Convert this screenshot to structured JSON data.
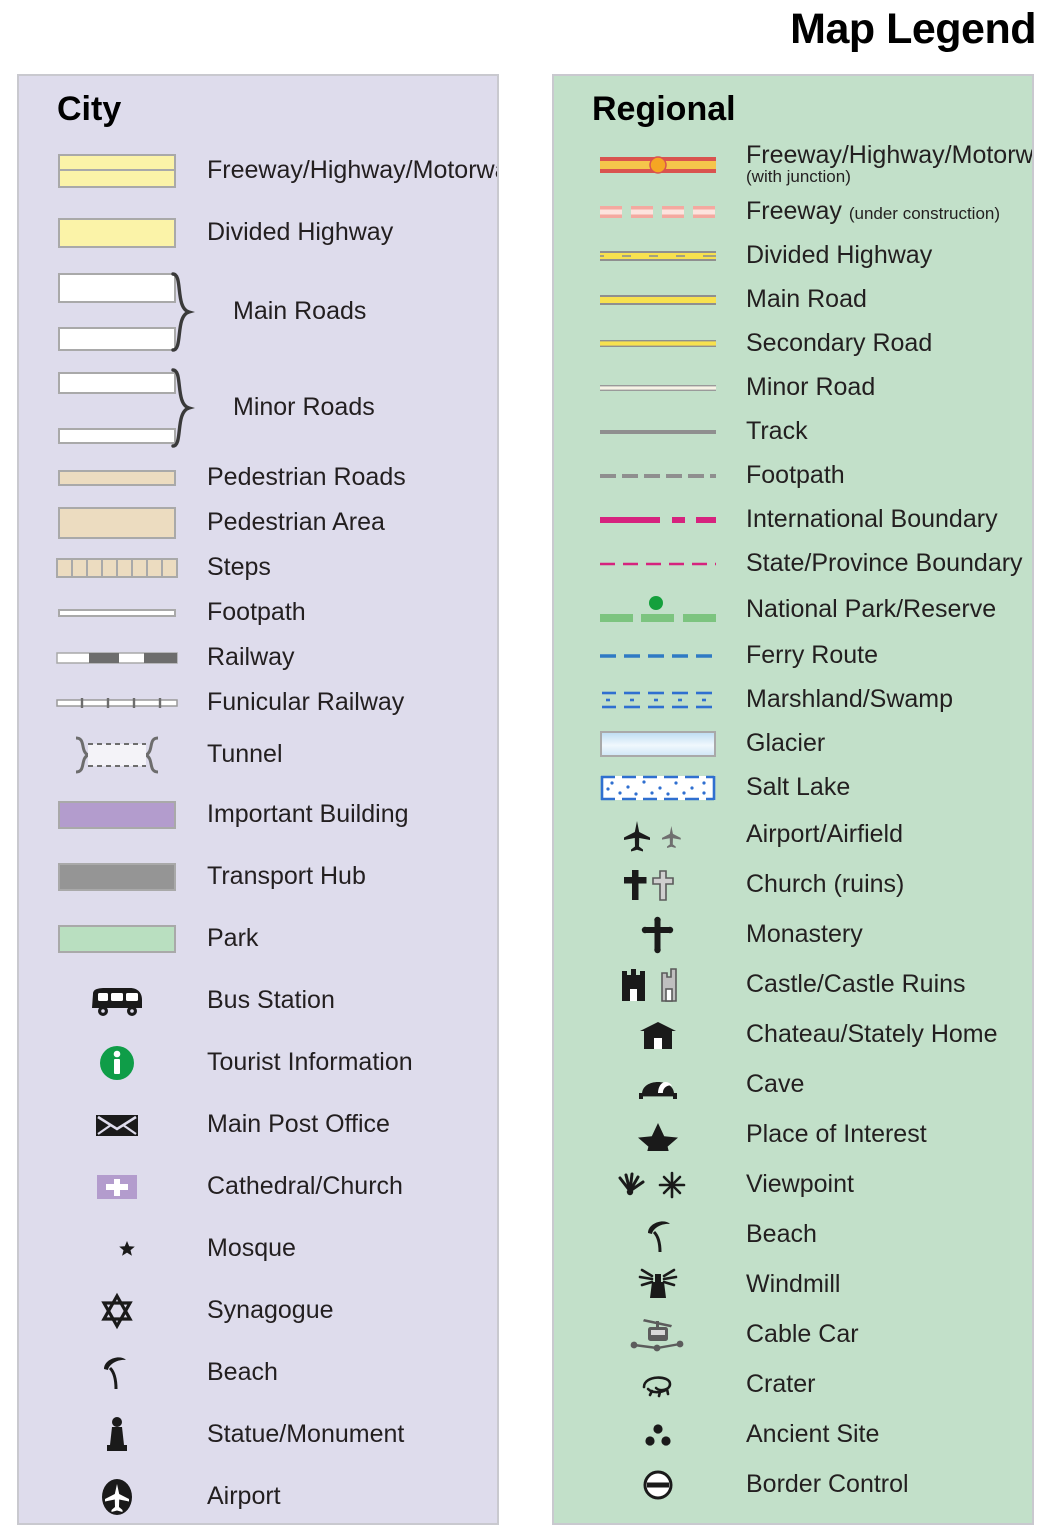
{
  "header": {
    "title": "Map Legend"
  },
  "colors": {
    "city_panel_bg": "#dedcec",
    "regional_panel_bg": "#c2e0c9",
    "panel_border": "#c9c9cf",
    "road_yellow": "#fbf3a8",
    "road_casing": "#a9a9a9",
    "pedestrian_tan": "#ecdcc0",
    "important_building": "#b39ccd",
    "transport_hub": "#959595",
    "park_green": "#b9dfc0",
    "freeway_red": "#d9534f",
    "freeway_fill": "#f5a623",
    "under_construction": "#f4a9a0",
    "main_road_yellow": "#f7e14f",
    "boundary_magenta": "#d6237e",
    "national_park_green": "#7cc47f",
    "ferry_blue": "#2f7ac4",
    "marsh_blue": "#2f6fd0",
    "glacier_blue": "#cfe8f7",
    "tourist_green": "#0f9d48",
    "text": "#231f20"
  },
  "city": {
    "title": "City",
    "items": [
      {
        "label": "Freeway/Highway/Motorway",
        "symbol": "double-yellow-bar"
      },
      {
        "label": "Divided Highway",
        "symbol": "thick-yellow-bar"
      },
      {
        "label": "Main Roads",
        "symbol": "two-white-bars-brace"
      },
      {
        "label": "Minor Roads",
        "symbol": "two-thin-white-bars-brace"
      },
      {
        "label": "Pedestrian Roads",
        "symbol": "tan-bar"
      },
      {
        "label": "Pedestrian Area",
        "symbol": "tan-area"
      },
      {
        "label": "Steps",
        "symbol": "steps-hatched-bar"
      },
      {
        "label": "Footpath",
        "symbol": "thin-white-line"
      },
      {
        "label": "Railway",
        "symbol": "railway-dashed-line"
      },
      {
        "label": "Funicular Railway",
        "symbol": "funicular-ticked-line"
      },
      {
        "label": "Tunnel",
        "symbol": "tunnel-brackets-dashed"
      },
      {
        "label": "Important Building",
        "symbol": "purple-area"
      },
      {
        "label": "Transport Hub",
        "symbol": "gray-area"
      },
      {
        "label": "Park",
        "symbol": "green-area"
      },
      {
        "label": "Bus Station",
        "symbol": "bus-icon"
      },
      {
        "label": "Tourist Information",
        "symbol": "information-icon"
      },
      {
        "label": "Main Post Office",
        "symbol": "envelope-icon"
      },
      {
        "label": "Cathedral/Church",
        "symbol": "cross-on-purple-icon"
      },
      {
        "label": "Mosque",
        "symbol": "crescent-star-icon"
      },
      {
        "label": "Synagogue",
        "symbol": "star-of-david-icon"
      },
      {
        "label": "Beach",
        "symbol": "parasol-icon"
      },
      {
        "label": "Statue/Monument",
        "symbol": "statue-icon"
      },
      {
        "label": "Airport",
        "symbol": "airplane-circle-icon"
      }
    ]
  },
  "regional": {
    "title": "Regional",
    "items": [
      {
        "label": "Freeway/Highway/Motorway",
        "sublabel": "(with junction)",
        "sub_position": "below",
        "symbol": "freeway-junction-line"
      },
      {
        "label": "Freeway",
        "sublabel": "(under construction)",
        "sub_position": "inline",
        "symbol": "freeway-dashed-line"
      },
      {
        "label": "Divided Highway",
        "symbol": "divided-highway-line"
      },
      {
        "label": "Main Road",
        "symbol": "main-road-line"
      },
      {
        "label": "Secondary Road",
        "symbol": "secondary-road-line"
      },
      {
        "label": "Minor Road",
        "symbol": "minor-road-line"
      },
      {
        "label": "Track",
        "symbol": "track-gray-line"
      },
      {
        "label": "Footpath",
        "symbol": "footpath-dashed-gray-line"
      },
      {
        "label": "International Boundary",
        "symbol": "international-boundary-line"
      },
      {
        "label": "State/Province Boundary",
        "symbol": "state-boundary-dashed-line"
      },
      {
        "label": "National Park/Reserve",
        "symbol": "national-park-line"
      },
      {
        "label": "Ferry Route",
        "symbol": "ferry-dashed-blue-line"
      },
      {
        "label": "Marshland/Swamp",
        "symbol": "marshland-pattern"
      },
      {
        "label": "Glacier",
        "symbol": "glacier-area"
      },
      {
        "label": "Salt Lake",
        "symbol": "salt-lake-area"
      },
      {
        "label": "Airport/Airfield",
        "symbol": "airplane-pair-icon"
      },
      {
        "label": "Church (ruins)",
        "symbol": "cross-pair-icon"
      },
      {
        "label": "Monastery",
        "symbol": "orthodox-cross-icon"
      },
      {
        "label": "Castle/Castle Ruins",
        "symbol": "castle-pair-icon"
      },
      {
        "label": "Chateau/Stately Home",
        "symbol": "chateau-icon"
      },
      {
        "label": "Cave",
        "symbol": "cave-icon"
      },
      {
        "label": "Place of Interest",
        "symbol": "star-icon"
      },
      {
        "label": "Viewpoint",
        "symbol": "viewpoint-pair-icon"
      },
      {
        "label": "Beach",
        "symbol": "parasol-icon"
      },
      {
        "label": "Windmill",
        "symbol": "windmill-icon"
      },
      {
        "label": "Cable Car",
        "symbol": "cable-car-icon"
      },
      {
        "label": "Crater",
        "symbol": "crater-icon"
      },
      {
        "label": "Ancient Site",
        "symbol": "ancient-site-dots-icon"
      },
      {
        "label": "Border Control",
        "symbol": "border-control-icon"
      }
    ]
  }
}
